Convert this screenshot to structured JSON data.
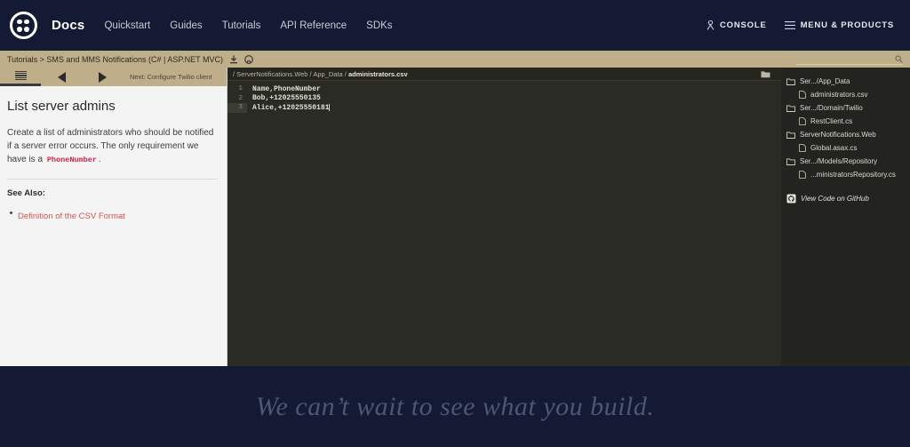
{
  "header": {
    "brand": "Docs",
    "logo_icon": "twilio-logo-icon",
    "nav_links": [
      {
        "label": "Quickstart"
      },
      {
        "label": "Guides"
      },
      {
        "label": "Tutorials"
      },
      {
        "label": "API Reference"
      },
      {
        "label": "SDKs"
      }
    ],
    "console_label": "CONSOLE",
    "console_icon": "user-icon",
    "menu_label": "MENU & PRODUCTS",
    "menu_icon": "hamburger-icon"
  },
  "breadcrumb": {
    "text": "Tutorials > SMS and MMS Notifications (C# | ASP.NET MVC)",
    "download_icon": "download-icon",
    "github_icon": "github-icon"
  },
  "search": {
    "value": "",
    "placeholder": "",
    "icon": "search-icon"
  },
  "doc_toolbar": {
    "menu_icon": "list-menu-icon",
    "prev_icon": "triangle-left-icon",
    "next_icon": "triangle-right-icon",
    "next_label": "Next: Configure Twilio client"
  },
  "doc": {
    "title": "List server admins",
    "paragraph_before": "Create a list of administrators who should be notified if a server error occurs. The only requirement we have is a ",
    "paragraph_code": "PhoneNumber",
    "paragraph_after": ".",
    "see_also_label": "See Also:",
    "links": [
      {
        "label": "Definition of the CSV Format"
      }
    ]
  },
  "code_panel": {
    "path_prefix": "/ ServerNotifications.Web / App_Data / ",
    "path_file": "administrators.csv",
    "folder_icon": "folder-icon",
    "lines": [
      {
        "num": "1",
        "text": "Name,PhoneNumber",
        "active": false
      },
      {
        "num": "2",
        "text": "Bob,+12025550135",
        "active": false
      },
      {
        "num": "3",
        "text": "Alice,+12025550181",
        "active": true
      }
    ]
  },
  "file_tree": {
    "nodes": [
      {
        "label": "Ser.../App_Data",
        "type": "folder",
        "icon": "folder-icon"
      },
      {
        "label": "administrators.csv",
        "type": "file",
        "icon": "file-icon"
      },
      {
        "label": "Ser.../Domain/Twilio",
        "type": "folder",
        "icon": "folder-icon"
      },
      {
        "label": "RestClient.cs",
        "type": "file",
        "icon": "file-icon"
      },
      {
        "label": "ServerNotifications.Web",
        "type": "folder",
        "icon": "folder-icon"
      },
      {
        "label": "Global.asax.cs",
        "type": "file",
        "icon": "file-icon"
      },
      {
        "label": "Ser.../Models/Repository",
        "type": "folder",
        "icon": "folder-icon"
      },
      {
        "label": "...ministratorsRepository.cs",
        "type": "file",
        "icon": "file-icon"
      }
    ],
    "github_link": "View Code on GitHub",
    "github_icon": "github-icon"
  },
  "footer": {
    "tagline": "We can’t wait to see what you build."
  },
  "colors": {
    "nav_background": "#141a33",
    "breadcrumb_background": "#bfae8a",
    "doc_background": "#f4f4f4",
    "code_background": "#2b2b26",
    "tree_background": "#232320",
    "accent_link": "#d9534f",
    "footer_text": "#4e5676"
  }
}
